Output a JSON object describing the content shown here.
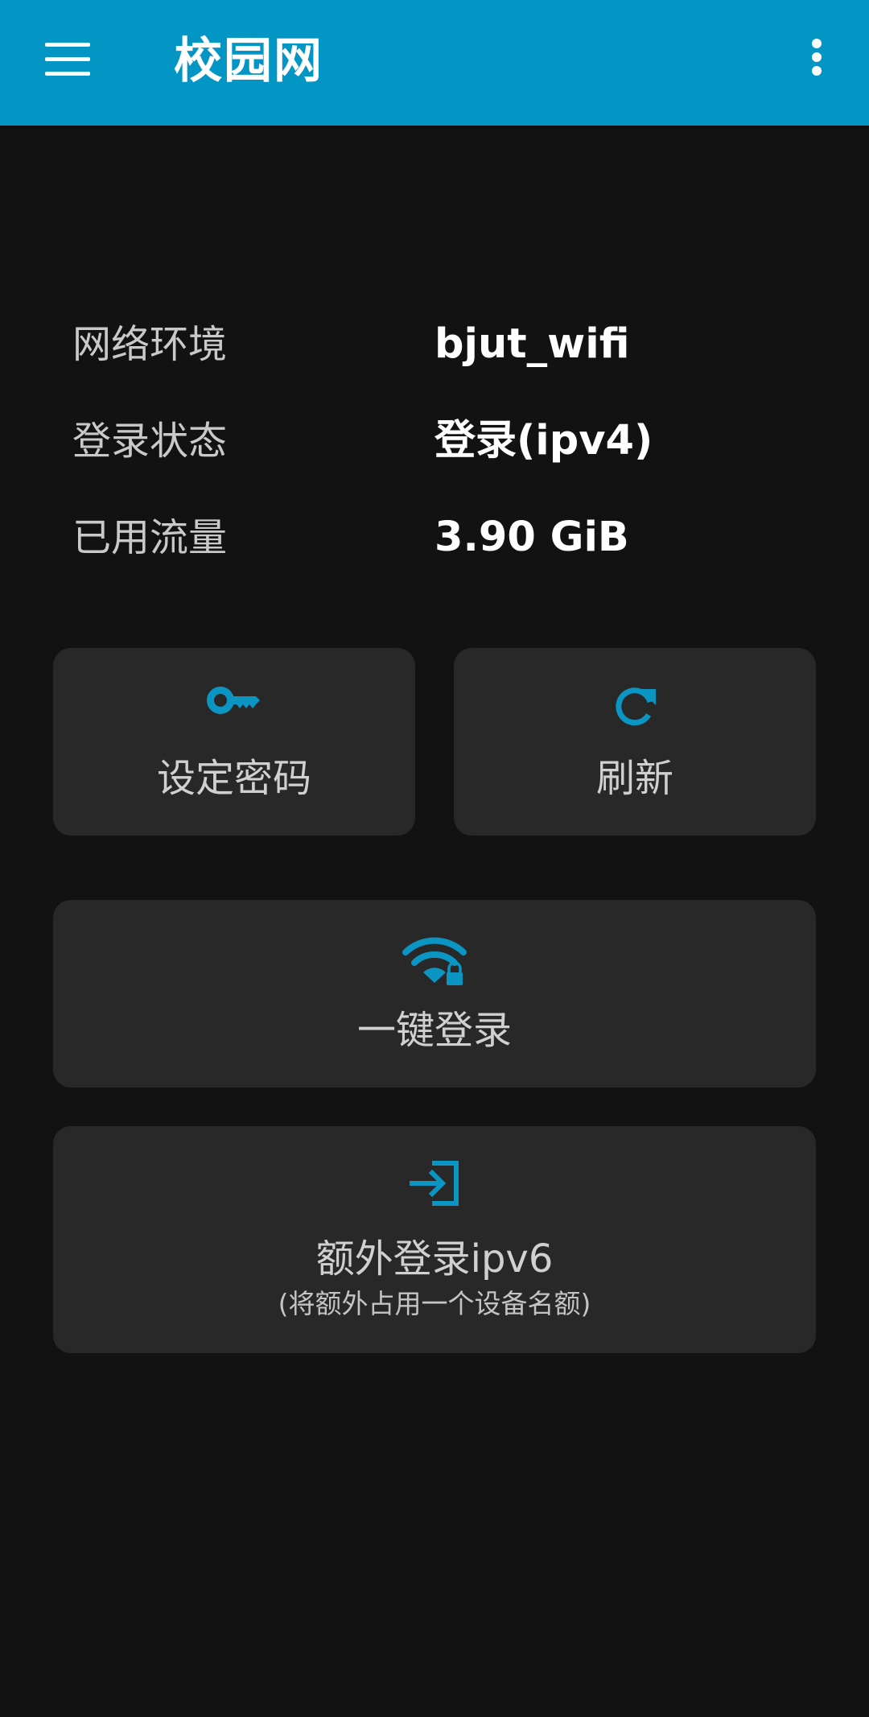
{
  "app_bar": {
    "title": "校园网",
    "background_color": "#0395c3",
    "menu_icon": "hamburger-menu-icon",
    "overflow_icon": "more-vert-icon"
  },
  "status": {
    "rows": [
      {
        "label": "网络环境",
        "value": "bjut_wifi"
      },
      {
        "label": "登录状态",
        "value": "登录(ipv4)"
      },
      {
        "label": "已用流量",
        "value": "3.90 GiB"
      }
    ]
  },
  "actions": {
    "accent_color": "#0a95c3",
    "set_password": {
      "label": "设定密码",
      "icon": "key-icon"
    },
    "refresh": {
      "label": "刷新",
      "icon": "refresh-icon"
    },
    "one_click_login": {
      "label": "一键登录",
      "icon": "wifi-lock-icon"
    },
    "extra_login_ipv6": {
      "label": "额外登录ipv6",
      "sublabel": "(将额外占用一个设备名额)",
      "icon": "login-icon"
    }
  }
}
